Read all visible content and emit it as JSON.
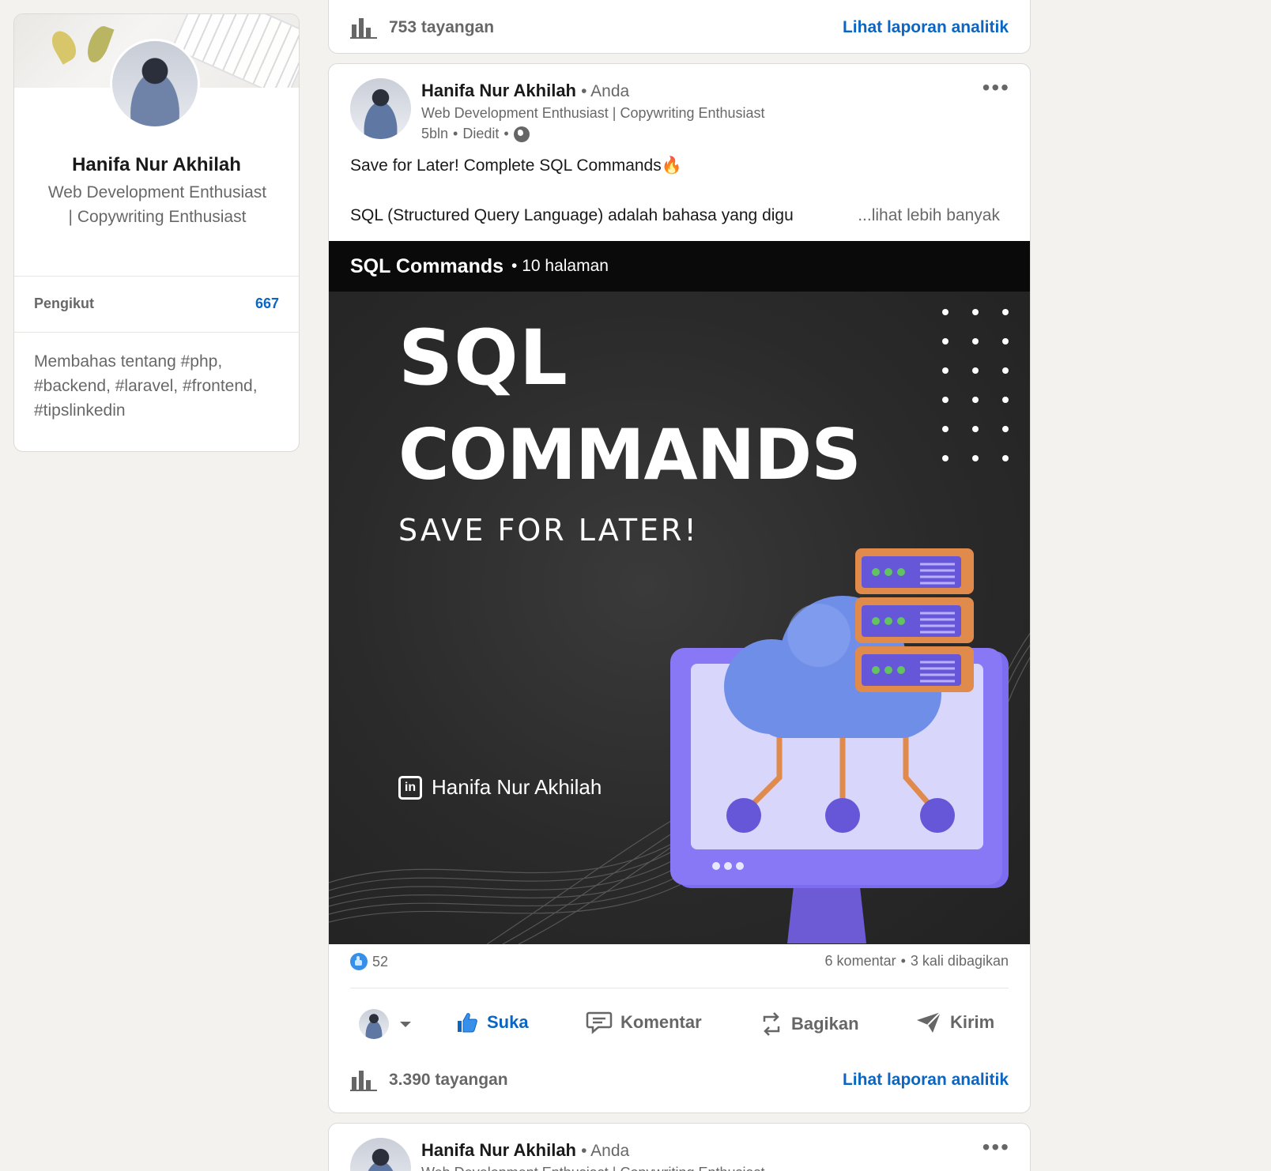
{
  "profile": {
    "name": "Hanifa Nur Akhilah",
    "headline": "Web Development Enthusiast | Copywriting Enthusiast",
    "followers_label": "Pengikut",
    "followers_count": "667",
    "about": "Membahas tentang #php, #backend, #laravel, #frontend, #tipslinkedin"
  },
  "top_card": {
    "views": "753 tayangan",
    "analytics_link": "Lihat laporan analitik"
  },
  "post": {
    "author_name": "Hanifa Nur Akhilah",
    "relation": "• Anda",
    "author_headline": "Web Development Enthusiast | Copywriting Enthusiast",
    "time": "5bln",
    "edited": "Diedit",
    "text_line1": "Save for Later! Complete SQL Commands🔥",
    "text_line2": "SQL (Structured Query Language) adalah bahasa yang digu",
    "see_more": "...lihat lebih banyak",
    "document": {
      "title": "SQL Commands",
      "pages": "• 10 halaman",
      "slide_title_1": "SQL",
      "slide_title_2": "COMMANDS",
      "slide_subtitle": "SAVE FOR LATER!",
      "slide_author": "Hanifa Nur Akhilah",
      "linkedin_mark": "in"
    },
    "reactions_count": "52",
    "comments": "6 komentar",
    "shares": "3 kali dibagikan",
    "actions": {
      "like": "Suka",
      "comment": "Komentar",
      "repost": "Bagikan",
      "send": "Kirim"
    },
    "views": "3.390 tayangan",
    "analytics_link": "Lihat laporan analitik"
  },
  "next_post": {
    "author_name": "Hanifa Nur Akhilah",
    "relation": "• Anda",
    "author_headline": "Web Development Enthusiast | Copywriting Enthusiast"
  },
  "colors": {
    "accent": "#0a66c2",
    "background": "#f3f2ef",
    "slide_purple": "#7b6cf0",
    "slide_orange": "#e08a4c"
  }
}
